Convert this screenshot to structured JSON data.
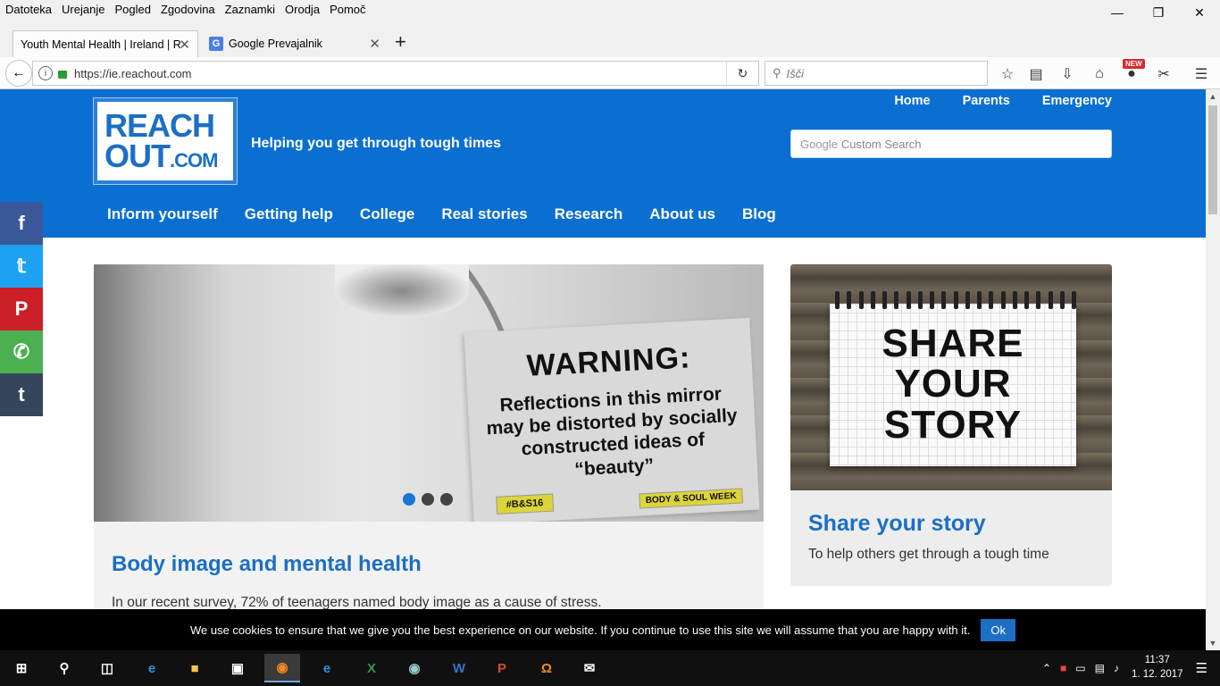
{
  "menubar": {
    "items": [
      "Datoteka",
      "Urejanje",
      "Pogled",
      "Zgodovina",
      "Zaznamki",
      "Orodja",
      "Pomoč"
    ]
  },
  "tabs": [
    {
      "title": "Youth Mental Health | Ireland | R"
    },
    {
      "title": "Google Prevajalnik"
    }
  ],
  "navbar": {
    "url": "https://ie.reachout.com",
    "search_placeholder": "Išči",
    "new_badge": "NEW"
  },
  "site": {
    "logo_line1": "REACH",
    "logo_line2": "OUT",
    "logo_suffix": ".COM",
    "tagline": "Helping you get through tough times",
    "toplinks": [
      "Home",
      "Parents",
      "Emergency"
    ],
    "search_brand": "Google",
    "search_placeholder": "Custom Search",
    "nav": [
      "Inform yourself",
      "Getting help",
      "College",
      "Real stories",
      "Research",
      "About us",
      "Blog"
    ]
  },
  "hero": {
    "warning_title": "WARNING:",
    "warning_text": "Reflections in this mirror may be distorted by socially constructed ideas of “beauty”",
    "tag1": "#B&S16",
    "tag2": "BODY & SOUL WEEK",
    "slide_count": 3,
    "active_slide": 1
  },
  "card": {
    "title": "Body image and mental health",
    "text": "In our recent survey, 72% of teenagers named body image as a cause of stress."
  },
  "side": {
    "pad_text": "SHARE YOUR STORY",
    "title": "Share your story",
    "text": "To help others get through a tough time"
  },
  "social": [
    {
      "name": "facebook",
      "glyph": "f",
      "color": "#3b5998"
    },
    {
      "name": "twitter",
      "glyph": "t",
      "color": "#1da1f2"
    },
    {
      "name": "pinterest",
      "glyph": "P",
      "color": "#cb2027"
    },
    {
      "name": "whatsapp",
      "glyph": "W",
      "color": "#4caf50"
    },
    {
      "name": "tumblr",
      "glyph": "t",
      "color": "#35465c"
    }
  ],
  "cookie": {
    "text": "We use cookies to ensure that we give you the best experience on our website. If you continue to use this site we will assume that you are happy with it.",
    "button": "Ok"
  },
  "taskbar": {
    "time": "11:37",
    "date": "1. 12. 2017"
  }
}
